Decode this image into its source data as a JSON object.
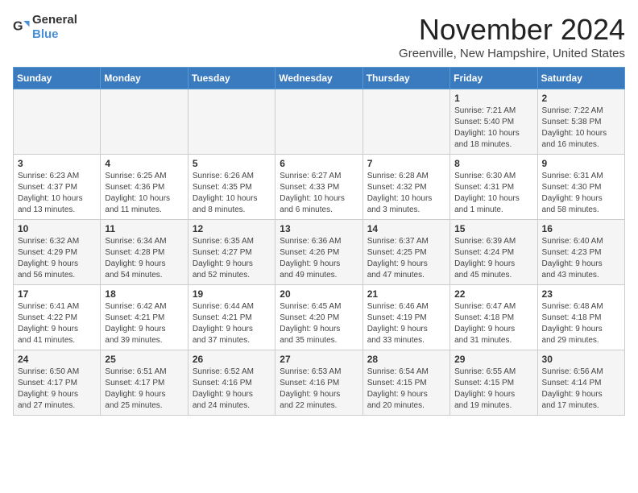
{
  "logo": {
    "text_general": "General",
    "text_blue": "Blue"
  },
  "title": "November 2024",
  "location": "Greenville, New Hampshire, United States",
  "days_of_week": [
    "Sunday",
    "Monday",
    "Tuesday",
    "Wednesday",
    "Thursday",
    "Friday",
    "Saturday"
  ],
  "weeks": [
    [
      {
        "day": "",
        "info": ""
      },
      {
        "day": "",
        "info": ""
      },
      {
        "day": "",
        "info": ""
      },
      {
        "day": "",
        "info": ""
      },
      {
        "day": "",
        "info": ""
      },
      {
        "day": "1",
        "info": "Sunrise: 7:21 AM\nSunset: 5:40 PM\nDaylight: 10 hours\nand 18 minutes."
      },
      {
        "day": "2",
        "info": "Sunrise: 7:22 AM\nSunset: 5:38 PM\nDaylight: 10 hours\nand 16 minutes."
      }
    ],
    [
      {
        "day": "3",
        "info": "Sunrise: 6:23 AM\nSunset: 4:37 PM\nDaylight: 10 hours\nand 13 minutes."
      },
      {
        "day": "4",
        "info": "Sunrise: 6:25 AM\nSunset: 4:36 PM\nDaylight: 10 hours\nand 11 minutes."
      },
      {
        "day": "5",
        "info": "Sunrise: 6:26 AM\nSunset: 4:35 PM\nDaylight: 10 hours\nand 8 minutes."
      },
      {
        "day": "6",
        "info": "Sunrise: 6:27 AM\nSunset: 4:33 PM\nDaylight: 10 hours\nand 6 minutes."
      },
      {
        "day": "7",
        "info": "Sunrise: 6:28 AM\nSunset: 4:32 PM\nDaylight: 10 hours\nand 3 minutes."
      },
      {
        "day": "8",
        "info": "Sunrise: 6:30 AM\nSunset: 4:31 PM\nDaylight: 10 hours\nand 1 minute."
      },
      {
        "day": "9",
        "info": "Sunrise: 6:31 AM\nSunset: 4:30 PM\nDaylight: 9 hours\nand 58 minutes."
      }
    ],
    [
      {
        "day": "10",
        "info": "Sunrise: 6:32 AM\nSunset: 4:29 PM\nDaylight: 9 hours\nand 56 minutes."
      },
      {
        "day": "11",
        "info": "Sunrise: 6:34 AM\nSunset: 4:28 PM\nDaylight: 9 hours\nand 54 minutes."
      },
      {
        "day": "12",
        "info": "Sunrise: 6:35 AM\nSunset: 4:27 PM\nDaylight: 9 hours\nand 52 minutes."
      },
      {
        "day": "13",
        "info": "Sunrise: 6:36 AM\nSunset: 4:26 PM\nDaylight: 9 hours\nand 49 minutes."
      },
      {
        "day": "14",
        "info": "Sunrise: 6:37 AM\nSunset: 4:25 PM\nDaylight: 9 hours\nand 47 minutes."
      },
      {
        "day": "15",
        "info": "Sunrise: 6:39 AM\nSunset: 4:24 PM\nDaylight: 9 hours\nand 45 minutes."
      },
      {
        "day": "16",
        "info": "Sunrise: 6:40 AM\nSunset: 4:23 PM\nDaylight: 9 hours\nand 43 minutes."
      }
    ],
    [
      {
        "day": "17",
        "info": "Sunrise: 6:41 AM\nSunset: 4:22 PM\nDaylight: 9 hours\nand 41 minutes."
      },
      {
        "day": "18",
        "info": "Sunrise: 6:42 AM\nSunset: 4:21 PM\nDaylight: 9 hours\nand 39 minutes."
      },
      {
        "day": "19",
        "info": "Sunrise: 6:44 AM\nSunset: 4:21 PM\nDaylight: 9 hours\nand 37 minutes."
      },
      {
        "day": "20",
        "info": "Sunrise: 6:45 AM\nSunset: 4:20 PM\nDaylight: 9 hours\nand 35 minutes."
      },
      {
        "day": "21",
        "info": "Sunrise: 6:46 AM\nSunset: 4:19 PM\nDaylight: 9 hours\nand 33 minutes."
      },
      {
        "day": "22",
        "info": "Sunrise: 6:47 AM\nSunset: 4:18 PM\nDaylight: 9 hours\nand 31 minutes."
      },
      {
        "day": "23",
        "info": "Sunrise: 6:48 AM\nSunset: 4:18 PM\nDaylight: 9 hours\nand 29 minutes."
      }
    ],
    [
      {
        "day": "24",
        "info": "Sunrise: 6:50 AM\nSunset: 4:17 PM\nDaylight: 9 hours\nand 27 minutes."
      },
      {
        "day": "25",
        "info": "Sunrise: 6:51 AM\nSunset: 4:17 PM\nDaylight: 9 hours\nand 25 minutes."
      },
      {
        "day": "26",
        "info": "Sunrise: 6:52 AM\nSunset: 4:16 PM\nDaylight: 9 hours\nand 24 minutes."
      },
      {
        "day": "27",
        "info": "Sunrise: 6:53 AM\nSunset: 4:16 PM\nDaylight: 9 hours\nand 22 minutes."
      },
      {
        "day": "28",
        "info": "Sunrise: 6:54 AM\nSunset: 4:15 PM\nDaylight: 9 hours\nand 20 minutes."
      },
      {
        "day": "29",
        "info": "Sunrise: 6:55 AM\nSunset: 4:15 PM\nDaylight: 9 hours\nand 19 minutes."
      },
      {
        "day": "30",
        "info": "Sunrise: 6:56 AM\nSunset: 4:14 PM\nDaylight: 9 hours\nand 17 minutes."
      }
    ]
  ]
}
